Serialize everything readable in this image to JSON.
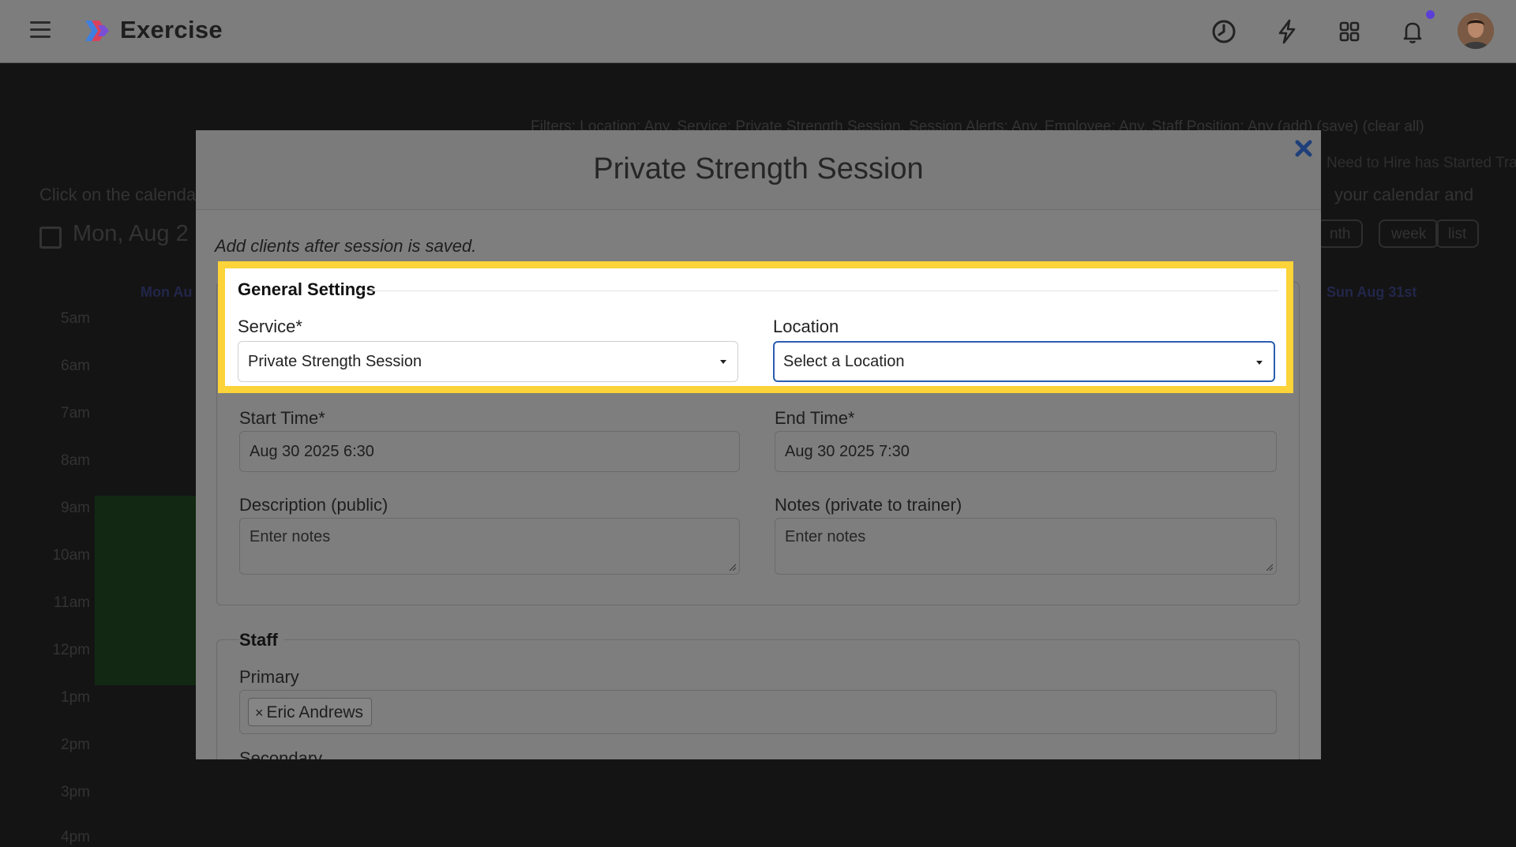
{
  "app": {
    "brand": "Exercise"
  },
  "topbar": {
    "icons": [
      "history-icon",
      "lightning-icon",
      "apps-grid-icon",
      "bell-icon"
    ]
  },
  "background": {
    "filter_line": "Filters: Location: Any, Service: Private Strength Session, Session Alerts: Any, Employee: Any, Staff Position: Any (add) (save) (clear all)",
    "filter_line2": "Need to Hire  has Started Training",
    "instructions_left": "Click on the calendar",
    "instructions_right": "your calendar and",
    "date_heading": "Mon, Aug 2",
    "view_buttons": [
      "nth",
      "week",
      "list"
    ],
    "col_left": "Mon Au",
    "col_right": "Sun Aug 31st",
    "hours": [
      "5am",
      "6am",
      "7am",
      "8am",
      "9am",
      "10am",
      "11am",
      "12pm",
      "1pm",
      "2pm",
      "3pm",
      "4pm"
    ]
  },
  "modal": {
    "title": "Private Strength Session",
    "note": "Add clients after session is saved.",
    "general": {
      "legend": "General Settings",
      "service_label": "Service*",
      "service_value": "Private Strength Session",
      "location_label": "Location",
      "location_value": "Select a Location",
      "start_label": "Start Time*",
      "start_value": "Aug 30 2025 6:30",
      "end_label": "End Time*",
      "end_value": "Aug 30 2025 7:30",
      "description_label": "Description (public)",
      "description_placeholder": "Enter notes",
      "notes_label": "Notes (private to trainer)",
      "notes_placeholder": "Enter notes"
    },
    "staff": {
      "legend": "Staff",
      "primary_label": "Primary",
      "primary_tag": "Eric Andrews",
      "tag_remove": "×",
      "secondary_label": "Secondary"
    }
  },
  "colors": {
    "highlight_border": "#fcd338",
    "focus_border": "#2a5db0",
    "notification_dot": "#5b3fd6"
  }
}
